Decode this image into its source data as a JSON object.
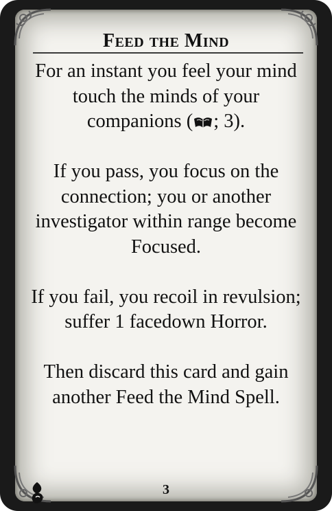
{
  "card": {
    "title": "Feed the Mind",
    "paragraphs": [
      {
        "before_icon": "For an instant you feel your mind touch the minds of your companions (",
        "icon": "lore-book-icon",
        "after_icon": "; 3)."
      },
      {
        "text": "If you pass, you focus on the connection; you or another investigator within range become Focused."
      },
      {
        "text": "If you fail, you recoil in revulsion; suffer 1 facedown Horror."
      },
      {
        "text": "Then discard this card and gain another Feed the Mind Spell."
      }
    ],
    "footer_icon": "spell-set-icon",
    "page_number": "3"
  }
}
